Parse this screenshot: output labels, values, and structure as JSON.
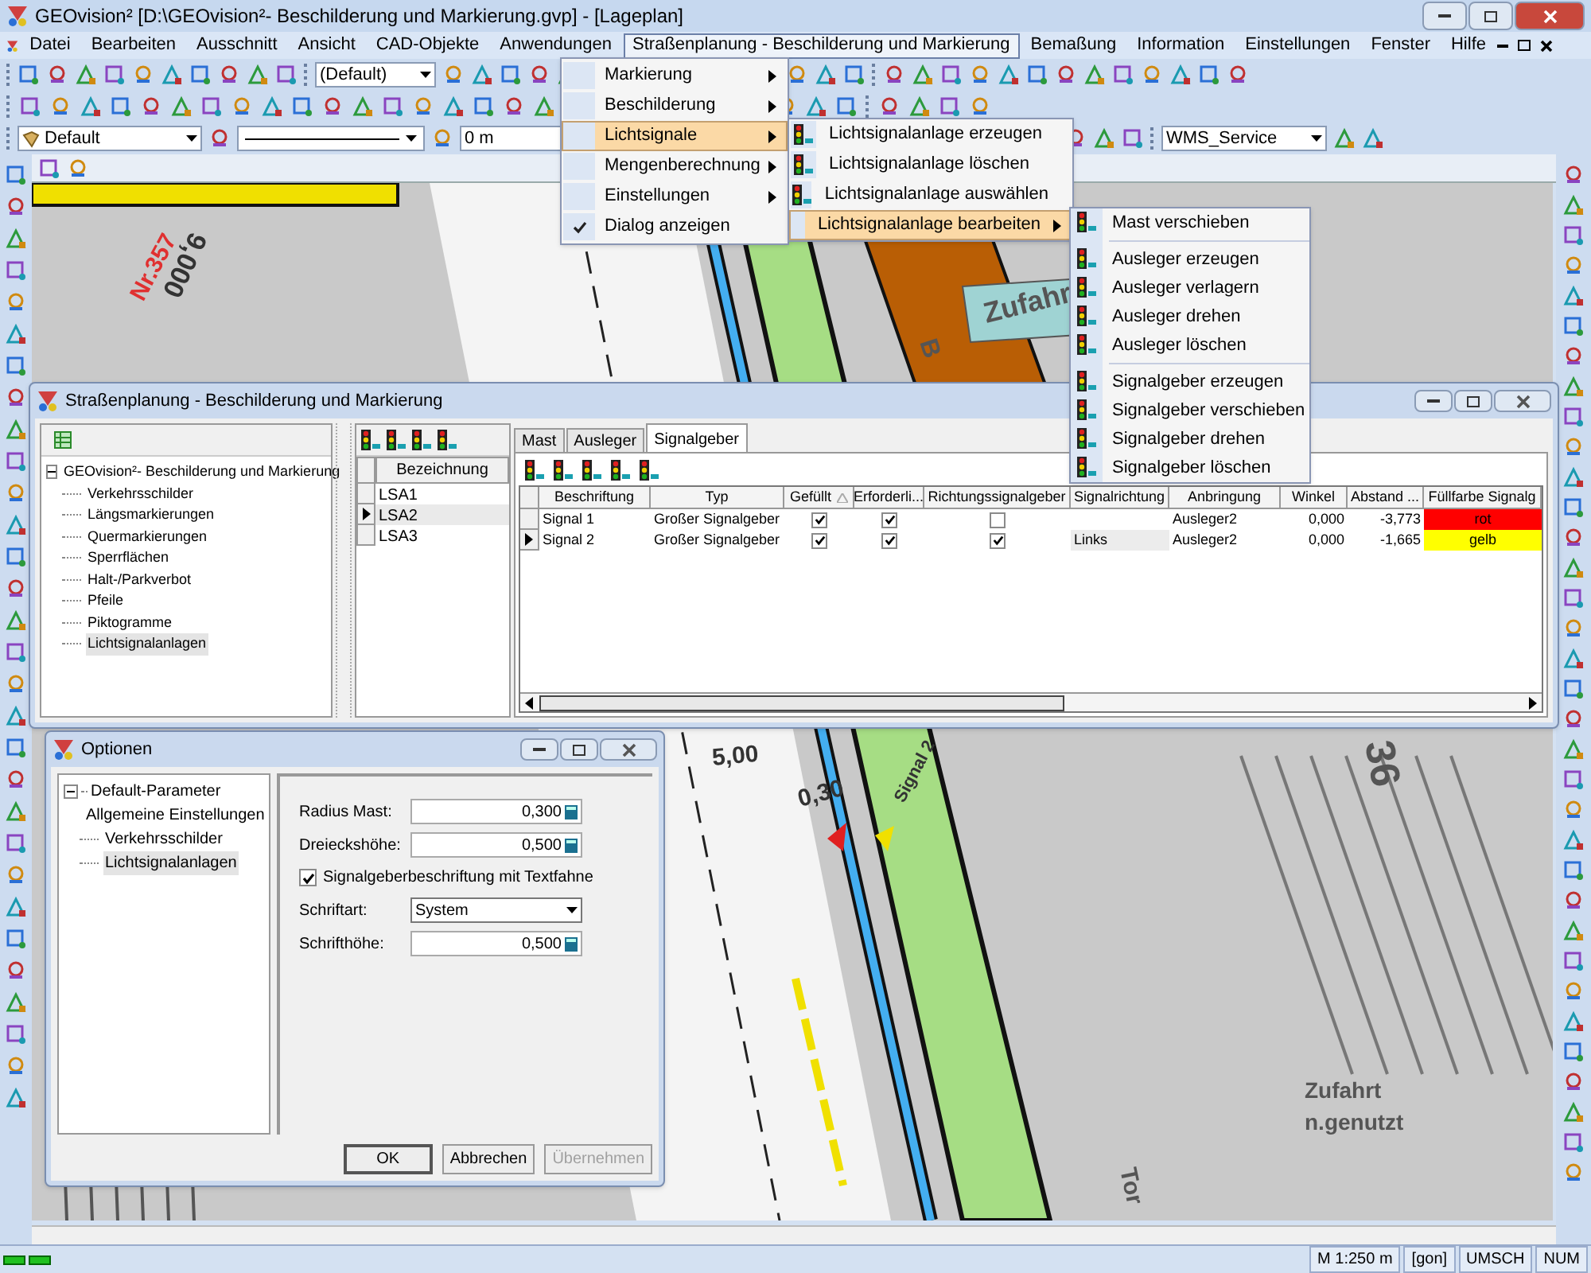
{
  "window": {
    "title": "GEOvision²  [D:\\GEOvision²- Beschilderung und Markierung.gvp] - [Lageplan]"
  },
  "menubar": [
    {
      "label": "Datei",
      "selected": false
    },
    {
      "label": "Bearbeiten",
      "selected": false
    },
    {
      "label": "Ausschnitt",
      "selected": false
    },
    {
      "label": "Ansicht",
      "selected": false
    },
    {
      "label": "CAD-Objekte",
      "selected": false
    },
    {
      "label": "Anwendungen",
      "selected": false
    },
    {
      "label": "Straßenplanung - Beschilderung und Markierung",
      "selected": true
    },
    {
      "label": "Bemaßung",
      "selected": false
    },
    {
      "label": "Information",
      "selected": false
    },
    {
      "label": "Einstellungen",
      "selected": false
    },
    {
      "label": "Fenster",
      "selected": false
    },
    {
      "label": "Hilfe",
      "selected": false
    }
  ],
  "toolbar": {
    "style_combo": "(Default)",
    "layer_combo": "Default",
    "offset_field": "0 m",
    "service_combo": "WMS_Service"
  },
  "menu": [
    {
      "label": "Markierung",
      "kind": "submenu",
      "checked": false,
      "selected": false
    },
    {
      "label": "Beschilderung",
      "kind": "submenu",
      "checked": false,
      "selected": false
    },
    {
      "label": "Lichtsignale",
      "kind": "submenu",
      "checked": false,
      "selected": true
    },
    {
      "label": "Mengenberechnung",
      "kind": "submenu",
      "checked": false,
      "selected": false
    },
    {
      "label": "Einstellungen",
      "kind": "submenu",
      "checked": false,
      "selected": false
    },
    {
      "label": "Dialog anzeigen",
      "kind": "command",
      "checked": true,
      "selected": false
    }
  ],
  "submenu": [
    {
      "label": "Lichtsignalanlage erzeugen",
      "kind": "command",
      "selected": false
    },
    {
      "label": "Lichtsignalanlage löschen",
      "kind": "command",
      "selected": false
    },
    {
      "label": "Lichtsignalanlage auswählen",
      "kind": "command",
      "selected": false
    },
    {
      "label": "Lichtsignalanlage bearbeiten",
      "kind": "submenu",
      "selected": true
    }
  ],
  "submenu2": [
    {
      "items": [
        "Mast verschieben"
      ]
    },
    {
      "items": [
        "Ausleger erzeugen",
        "Ausleger verlagern",
        "Ausleger drehen",
        "Ausleger löschen"
      ]
    },
    {
      "items": [
        "Signalgeber erzeugen",
        "Signalgeber verschieben",
        "Signalgeber drehen",
        "Signalgeber löschen"
      ]
    }
  ],
  "dialog": {
    "title": "Straßenplanung - Beschilderung und Markierung",
    "tree": {
      "label": "GEOvision²- Beschilderung und Markierung",
      "expanded": true,
      "children": [
        {
          "label": "Verkehrsschilder",
          "selected": false
        },
        {
          "label": "Längsmarkierungen",
          "selected": false
        },
        {
          "label": "Quermarkierungen",
          "selected": false
        },
        {
          "label": "Sperrflächen",
          "selected": false
        },
        {
          "label": "Halt-/Parkverbot",
          "selected": false
        },
        {
          "label": "Pfeile",
          "selected": false
        },
        {
          "label": "Piktogramme",
          "selected": false
        },
        {
          "label": "Lichtsignalanlagen",
          "selected": true
        }
      ]
    },
    "lsa_list": {
      "column": "Bezeichnung",
      "rows": [
        {
          "label": "LSA1",
          "selected": false
        },
        {
          "label": "LSA2",
          "selected": true
        },
        {
          "label": "LSA3",
          "selected": false
        }
      ]
    },
    "tabs": [
      {
        "label": "Mast",
        "selected": false
      },
      {
        "label": "Ausleger",
        "selected": false
      },
      {
        "label": "Signalgeber",
        "selected": true
      }
    ],
    "table": {
      "columns": [
        {
          "label": "Beschriftung",
          "sorted": false
        },
        {
          "label": "Typ",
          "sorted": false
        },
        {
          "label": "Gefüllt",
          "sorted": true
        },
        {
          "label": "Erforderli...",
          "sorted": false
        },
        {
          "label": "Richtungssignalgeber",
          "sorted": false
        },
        {
          "label": "Signalrichtung",
          "sorted": false
        },
        {
          "label": "Anbringung",
          "sorted": false
        },
        {
          "label": "Winkel",
          "sorted": false
        },
        {
          "label": "Abstand ...",
          "sorted": false
        },
        {
          "label": "Füllfarbe Signalg",
          "sorted": false
        }
      ],
      "rows": [
        {
          "selected": false,
          "cells": [
            {
              "kind": "text",
              "text": "Signal 1"
            },
            {
              "kind": "text",
              "text": "Großer Signalgeber"
            },
            {
              "kind": "check",
              "checked": true
            },
            {
              "kind": "check",
              "checked": true
            },
            {
              "kind": "check",
              "checked": false
            },
            {
              "kind": "empty"
            },
            {
              "kind": "text",
              "text": "Ausleger2"
            },
            {
              "kind": "number",
              "text": "0,000"
            },
            {
              "kind": "number",
              "text": "-3,773"
            },
            {
              "kind": "color",
              "text": "rot",
              "color": "#ff0000"
            }
          ]
        },
        {
          "selected": true,
          "cells": [
            {
              "kind": "text",
              "text": "Signal 2"
            },
            {
              "kind": "text",
              "text": "Großer Signalgeber"
            },
            {
              "kind": "check",
              "checked": true
            },
            {
              "kind": "check",
              "checked": true
            },
            {
              "kind": "check",
              "checked": true
            },
            {
              "kind": "shaded",
              "text": "Links"
            },
            {
              "kind": "text",
              "text": "Ausleger2"
            },
            {
              "kind": "number",
              "text": "0,000"
            },
            {
              "kind": "number",
              "text": "-1,665"
            },
            {
              "kind": "color",
              "text": "gelb",
              "color": "#ffff00"
            }
          ]
        }
      ]
    }
  },
  "options": {
    "title": "Optionen",
    "tree": {
      "label": "Default-Parameter",
      "expanded": true,
      "children": [
        {
          "label": "Allgemeine Einstellungen",
          "selected": false
        },
        {
          "label": "Verkehrsschilder",
          "selected": false
        },
        {
          "label": "Lichtsignalanlagen",
          "selected": true
        }
      ]
    },
    "fields": [
      {
        "kind": "number",
        "label": "Radius Mast:",
        "value": "0,300"
      },
      {
        "kind": "number",
        "label": "Dreieckshöhe:",
        "value": "0,500"
      },
      {
        "kind": "checkbox",
        "label": "Signalgeberbeschriftung mit Textfahne",
        "checked": true
      },
      {
        "kind": "select",
        "label": "Schriftart:",
        "value": "System"
      },
      {
        "kind": "number",
        "label": "Schrifthöhe:",
        "value": "0,500"
      }
    ],
    "buttons": [
      {
        "label": "OK",
        "disabled": false
      },
      {
        "label": "Abbrechen",
        "disabled": false
      },
      {
        "label": "Übernehmen",
        "disabled": true
      }
    ]
  },
  "map_labels": [
    "Nr.357",
    "9,000",
    "5,00",
    "0,30",
    "Signal 2",
    "Zufahr",
    "B",
    "36",
    "Zufahrt",
    "n.genutzt",
    "Tor"
  ],
  "status_bar": [
    "M 1:250  m",
    "[gon]",
    "UMSCH",
    "NUM"
  ]
}
